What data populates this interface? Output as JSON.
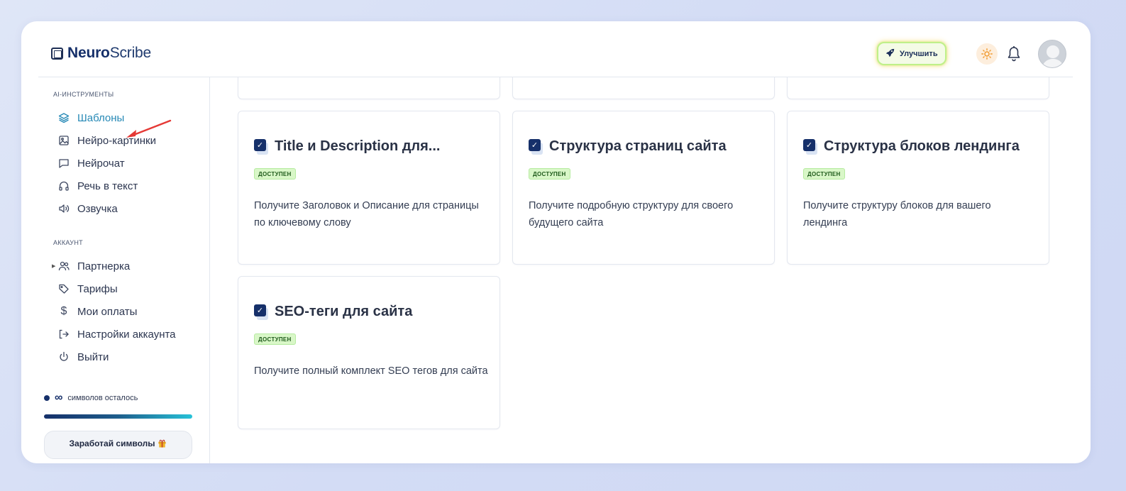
{
  "app": {
    "logo_bold": "Neuro",
    "logo_light": "Scribe"
  },
  "header": {
    "upgrade_label": "Улучшить"
  },
  "sidebar": {
    "section_tools": "AI-ИНСТРУМЕНТЫ",
    "tools": [
      {
        "label": "Шаблоны",
        "icon": "layers-icon",
        "active": true
      },
      {
        "label": "Нейро-картинки",
        "icon": "image-icon"
      },
      {
        "label": "Нейрочат",
        "icon": "chat-icon"
      },
      {
        "label": "Речь в текст",
        "icon": "headphones-icon"
      },
      {
        "label": "Озвучка",
        "icon": "speaker-icon"
      }
    ],
    "section_account": "АККАУНТ",
    "account": [
      {
        "label": "Партнерка",
        "icon": "users-icon"
      },
      {
        "label": "Тарифы",
        "icon": "tag-icon"
      },
      {
        "label": "Мои оплаты",
        "icon": "dollar-icon"
      },
      {
        "label": "Настройки аккаунта",
        "icon": "settings-icon"
      },
      {
        "label": "Выйти",
        "icon": "power-icon"
      }
    ],
    "symbols_infinity": "∞",
    "symbols_label": "символов осталось",
    "symbols_progress_fraction": 1.0,
    "earn_label": "Заработай символы"
  },
  "cards": [
    {
      "title": "Title и Description для...",
      "badge": "ДОСТУПЕН",
      "description": "Получите Заголовок и Описание для страницы по ключевому слову"
    },
    {
      "title": "Структура страниц сайта",
      "badge": "ДОСТУПЕН",
      "description": "Получите подробную структуру для своего будущего сайта"
    },
    {
      "title": "Структура блоков лендинга",
      "badge": "ДОСТУПЕН",
      "description": "Получите структуру блоков для вашего лендинга"
    },
    {
      "title": "SEO-теги для сайта",
      "badge": "ДОСТУПЕН",
      "description": "Получите полный комплект SEO тегов для сайта"
    }
  ],
  "colors": {
    "brand": "#16306a",
    "active_nav": "#2689b6",
    "badge_bg": "#d9f7c8",
    "annotation_arrow": "#e53935"
  }
}
